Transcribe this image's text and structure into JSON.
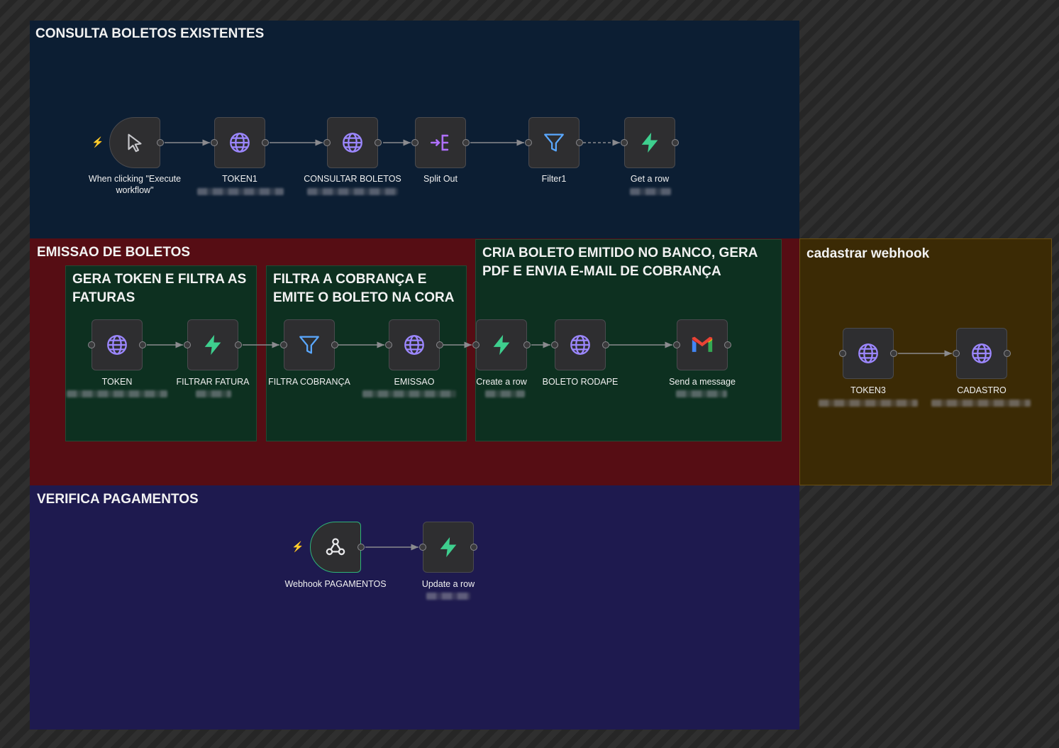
{
  "colors": {
    "group_consulta": "#0c1e33",
    "group_emissao": "#560d14",
    "group_green": "#0d3020",
    "group_webhook": "#3b2a05",
    "group_verifica": "#1e1a4f",
    "globe_icon": "#9c87ff",
    "bolt_icon": "#3ecf8e",
    "filter_icon": "#5aa8ff",
    "split_icon": "#b070ff"
  },
  "groups": {
    "consulta": "CONSULTA BOLETOS EXISTENTES",
    "emissao": "EMISSAO DE BOLETOS",
    "gera_token": "GERA TOKEN E FILTRA AS FATURAS",
    "filtra_cobranca": "FILTRA A COBRANÇA E EMITE O BOLETO NA CORA",
    "cria_boleto": "CRIA BOLETO EMITIDO NO BANCO, GERA PDF E ENVIA E-MAIL DE COBRANÇA",
    "webhook": "cadastrar webhook",
    "verifica": "VERIFICA PAGAMENTOS"
  },
  "nodes": {
    "manual_trigger": {
      "label": "When clicking \"Execute workflow\"",
      "icon": "cursor-icon"
    },
    "token1": {
      "label": "TOKEN1",
      "icon": "globe-icon"
    },
    "consultar_boletos": {
      "label": "CONSULTAR BOLETOS",
      "icon": "globe-icon"
    },
    "split_out": {
      "label": "Split Out",
      "icon": "split-icon"
    },
    "filter1": {
      "label": "Filter1",
      "icon": "filter-icon"
    },
    "get_row": {
      "label": "Get a row",
      "icon": "bolt-icon"
    },
    "token": {
      "label": "TOKEN",
      "icon": "globe-icon"
    },
    "filtrar_fatura": {
      "label": "FILTRAR FATURA",
      "icon": "bolt-icon"
    },
    "filtra_cobranca": {
      "label": "FILTRA COBRANÇA",
      "icon": "filter-icon"
    },
    "emissao": {
      "label": "EMISSAO",
      "icon": "globe-icon"
    },
    "create_row": {
      "label": "Create a row",
      "icon": "bolt-icon"
    },
    "boleto_rodape": {
      "label": "BOLETO RODAPE",
      "icon": "globe-icon"
    },
    "send_message": {
      "label": "Send a message",
      "icon": "gmail-icon"
    },
    "token3": {
      "label": "TOKEN3",
      "icon": "globe-icon"
    },
    "cadastro": {
      "label": "CADASTRO",
      "icon": "globe-icon"
    },
    "webhook_pagamentos": {
      "label": "Webhook PAGAMENTOS",
      "icon": "webhook-icon"
    },
    "update_row": {
      "label": "Update a row",
      "icon": "bolt-icon"
    }
  }
}
